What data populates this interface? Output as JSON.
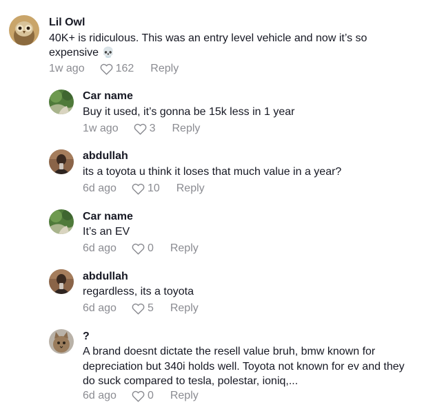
{
  "comments": [
    {
      "user": "Lil Owl",
      "text": "40K+ is ridiculous. This was an entry level vehicle and now it’s so expensive",
      "emoji": "💀",
      "date": "1w ago",
      "likes": "162",
      "reply_label": "Reply",
      "avatar": "owl-avatar"
    },
    {
      "user": "Car name",
      "text": "Buy it used, it’s gonna be 15k less in 1 year",
      "date": "1w ago",
      "likes": "3",
      "reply_label": "Reply",
      "avatar": "nature-avatar"
    },
    {
      "user": "abdullah",
      "text": "its a toyota u think it loses that much value in a year?",
      "date": "6d ago",
      "likes": "10",
      "reply_label": "Reply",
      "avatar": "person-avatar"
    },
    {
      "user": "Car name",
      "text": "It’s an EV",
      "date": "6d ago",
      "likes": "0",
      "reply_label": "Reply",
      "avatar": "nature-avatar"
    },
    {
      "user": "abdullah",
      "text": "regardless, its a toyota",
      "date": "6d ago",
      "likes": "5",
      "reply_label": "Reply",
      "avatar": "person-avatar"
    },
    {
      "user": "?",
      "text": "A brand doesnt dictate the resell value bruh, bmw known for depreciation but 340i holds well. Toyota not known for ev and they do suck compared to tesla, polestar, ioniq,...",
      "date": "6d ago",
      "likes": "0",
      "reply_label": "Reply",
      "avatar": "cat-avatar"
    }
  ],
  "colors": {
    "primary_text": "#161823",
    "secondary_text": "#8a8b91"
  }
}
